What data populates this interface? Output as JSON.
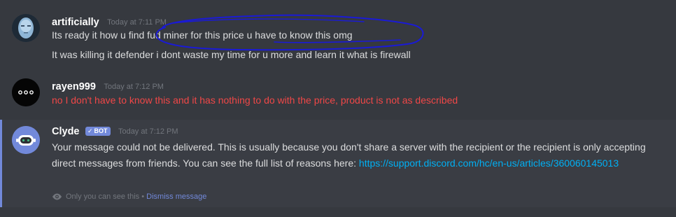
{
  "messages": [
    {
      "username": "artificially",
      "timestamp": "Today at 7:11 PM",
      "lines": [
        "Its ready it how u find fud miner for this price u have to know this omg",
        "It was killing it defender i dont waste my time for u more and learn it what is firewall"
      ]
    },
    {
      "username": "rayen999",
      "timestamp": "Today at 7:12 PM",
      "lines": [
        "no I don't have to know this and it has nothing to do with the price, product is not as described"
      ]
    },
    {
      "username": "Clyde",
      "bot_tag": "BOT",
      "timestamp": "Today at 7:12 PM",
      "text": "Your message could not be delivered. This is usually because you don't share a server with the recipient or the recipient is only accepting direct messages from friends. You can see the full list of reasons here: ",
      "link": "https://support.discord.com/hc/en-us/articles/360060145013",
      "ephemeral_note": "Only you can see this",
      "separator": "•",
      "dismiss_label": "Dismiss message"
    }
  ],
  "colors": {
    "background": "#36393f",
    "highlight": "#3a3d44",
    "accent": "#7289da",
    "link": "#00b0f4",
    "error_text": "#f04747",
    "scribble": "#1a1ad6"
  },
  "icons": {
    "bot_check": "checkmark-icon",
    "ephemeral": "eye-icon"
  }
}
